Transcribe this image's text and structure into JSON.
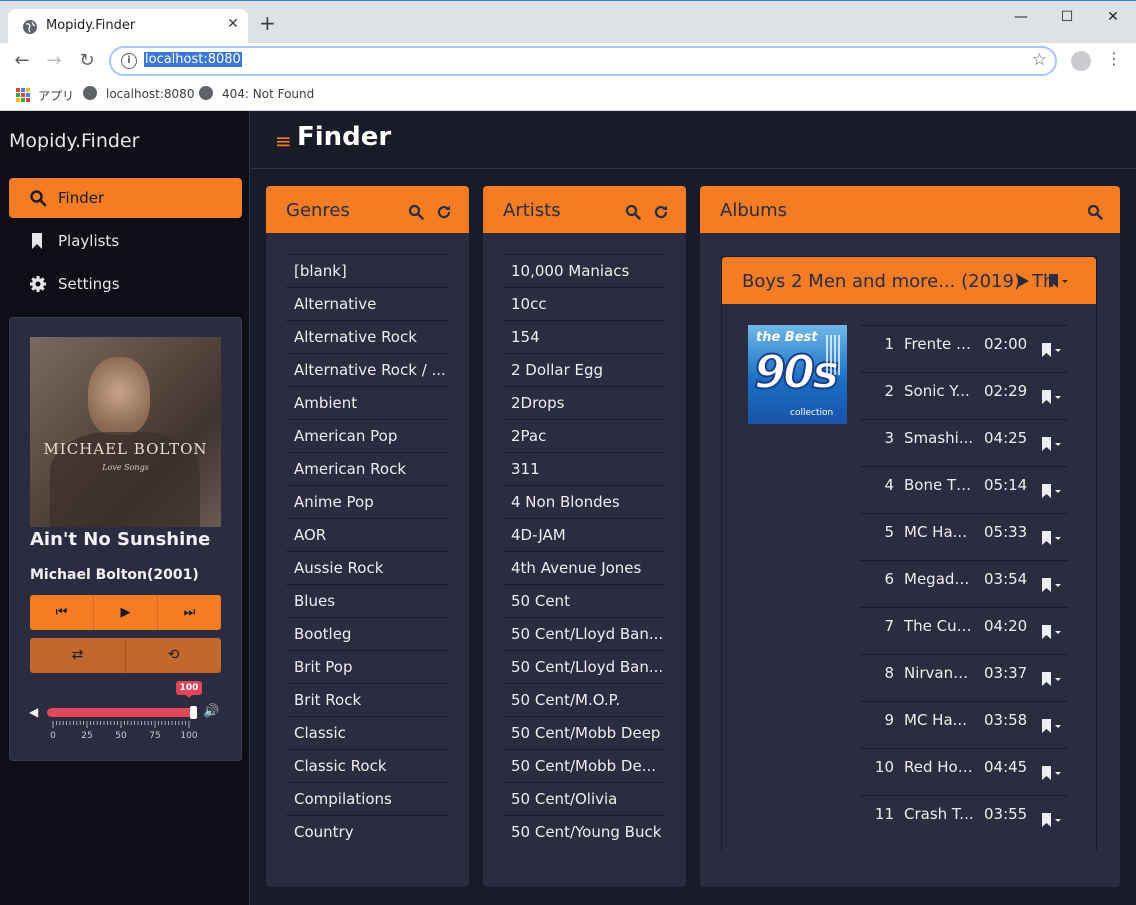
{
  "browser": {
    "tab_title": "Mopidy.Finder",
    "tab_close": "✕",
    "new_tab": "+",
    "url": "localhost:8080",
    "bookmarks": [
      {
        "label": "アプリ"
      },
      {
        "label": "localhost:8080"
      },
      {
        "label": "404: Not Found"
      }
    ],
    "window": {
      "minimize": "—",
      "maximize": "☐",
      "close": "✕"
    }
  },
  "sidebar": {
    "brand": "Mopidy.Finder",
    "items": [
      {
        "label": "Finder",
        "icon": "search-icon",
        "active": true
      },
      {
        "label": "Playlists",
        "icon": "bookmark-icon",
        "active": false
      },
      {
        "label": "Settings",
        "icon": "gear-icon",
        "active": false
      }
    ]
  },
  "player": {
    "cover_artist": "MICHAEL BOLTON",
    "cover_subtitle": "Love Songs",
    "title": "Ain't No Sunshine",
    "artist": "Michael Bolton(2001)",
    "volume": 100,
    "volume_label": "100",
    "volume_scale": [
      "0",
      "25",
      "50",
      "75",
      "100"
    ]
  },
  "header": {
    "title": "Finder"
  },
  "genres": {
    "title": "Genres",
    "items": [
      "[blank]",
      "Alternative",
      "Alternative Rock",
      "Alternative Rock / ...",
      "Ambient",
      "American Pop",
      "American Rock",
      "Anime Pop",
      "AOR",
      "Aussie Rock",
      "Blues",
      "Bootleg",
      "Brit Pop",
      "Brit Rock",
      "Classic",
      "Classic Rock",
      "Compilations",
      "Country"
    ]
  },
  "artists": {
    "title": "Artists",
    "items": [
      "10,000 Maniacs",
      "10cc",
      "154",
      "2 Dollar Egg",
      "2Drops",
      "2Pac",
      "311",
      "4 Non Blondes",
      "4D-JAM",
      "4th Avenue Jones",
      "50 Cent",
      "50 Cent/Lloyd Ban...",
      "50 Cent/Lloyd Ban...",
      "50 Cent/M.O.P.",
      "50 Cent/Mobb Deep",
      "50 Cent/Mobb De...",
      "50 Cent/Olivia",
      "50 Cent/Young Buck"
    ]
  },
  "albums": {
    "title": "Albums",
    "album_title": "Boys 2 Men and more... (2019)",
    "album_title_overflow": "Th",
    "art_text_1": "the Best",
    "art_text_2": "90s",
    "art_text_3": "collection",
    "tracks": [
      {
        "no": "1",
        "title": "Frente /...",
        "dur": "02:00"
      },
      {
        "no": "2",
        "title": "Sonic Y...",
        "dur": "02:29"
      },
      {
        "no": "3",
        "title": "Smashi...",
        "dur": "04:25"
      },
      {
        "no": "4",
        "title": "Bone Th...",
        "dur": "05:14"
      },
      {
        "no": "5",
        "title": "MC Ha...",
        "dur": "05:33"
      },
      {
        "no": "6",
        "title": "Megade...",
        "dur": "03:54"
      },
      {
        "no": "7",
        "title": "The Cur...",
        "dur": "04:20"
      },
      {
        "no": "8",
        "title": "Nirvana...",
        "dur": "03:37"
      },
      {
        "no": "9",
        "title": "MC Ha...",
        "dur": "03:58"
      },
      {
        "no": "10",
        "title": "Red Hot...",
        "dur": "04:45"
      },
      {
        "no": "11",
        "title": "Crash T...",
        "dur": "03:55"
      }
    ]
  },
  "colors": {
    "accent": "#f57c22",
    "panel": "#2b2c40",
    "volume": "#e0485a"
  }
}
